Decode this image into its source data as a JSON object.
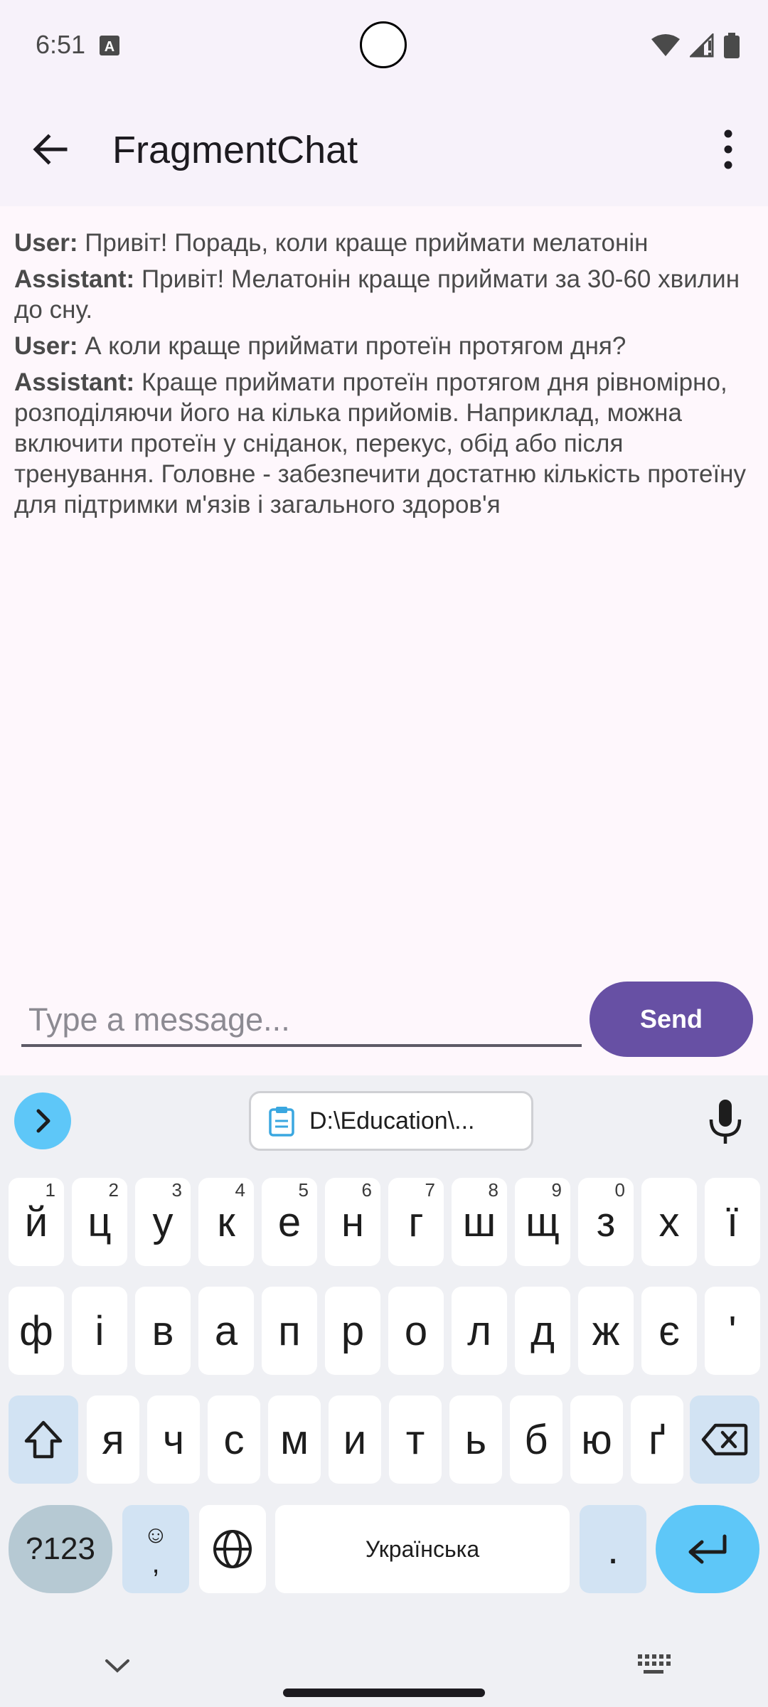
{
  "status_bar": {
    "time": "6:51",
    "icons": [
      "notification-a-icon",
      "wifi-icon",
      "signal-icon",
      "battery-icon"
    ]
  },
  "toolbar": {
    "title": "FragmentChat",
    "back_icon": "arrow-back-icon",
    "menu_icon": "more-vert-icon"
  },
  "chat": {
    "messages": [
      {
        "speaker": "User:",
        "text": "Привіт! Порадь, коли краще приймати мелатонін"
      },
      {
        "speaker": "Assistant:",
        "text": "Привіт! Мелатонін краще приймати за 30-60 хвилин до сну."
      },
      {
        "speaker": "User:",
        "text": "А коли краще приймати протеїн протягом дня?"
      },
      {
        "speaker": "Assistant:",
        "text": "Краще приймати протеїн протягом дня рівномірно, розподіляючи його на кілька прийомів. Наприклад, можна включити протеїн у сніданок, перекус, обід або після тренування. Головне - забезпечити достатню кількість протеїну для підтримки м'язів і загального здоров'я"
      }
    ]
  },
  "input": {
    "placeholder": "Type a message...",
    "value": "",
    "send_label": "Send"
  },
  "keyboard": {
    "clipboard_text": "D:\\Education\\...",
    "row1": [
      {
        "k": "й",
        "h": "1"
      },
      {
        "k": "ц",
        "h": "2"
      },
      {
        "k": "у",
        "h": "3"
      },
      {
        "k": "к",
        "h": "4"
      },
      {
        "k": "е",
        "h": "5"
      },
      {
        "k": "н",
        "h": "6"
      },
      {
        "k": "г",
        "h": "7"
      },
      {
        "k": "ш",
        "h": "8"
      },
      {
        "k": "щ",
        "h": "9"
      },
      {
        "k": "з",
        "h": "0"
      },
      {
        "k": "х",
        "h": ""
      },
      {
        "k": "ї",
        "h": ""
      }
    ],
    "row2": [
      "ф",
      "і",
      "в",
      "а",
      "п",
      "р",
      "о",
      "л",
      "д",
      "ж",
      "є",
      "'"
    ],
    "row3": [
      "я",
      "ч",
      "с",
      "м",
      "и",
      "т",
      "ь",
      "б",
      "ю",
      "ґ"
    ],
    "symbols_label": "?123",
    "emoji_label": "☺",
    "comma_label": ",",
    "space_label": "Українська",
    "period_label": ".",
    "accent": "#5ec7f8",
    "brand": "#6750a4"
  }
}
